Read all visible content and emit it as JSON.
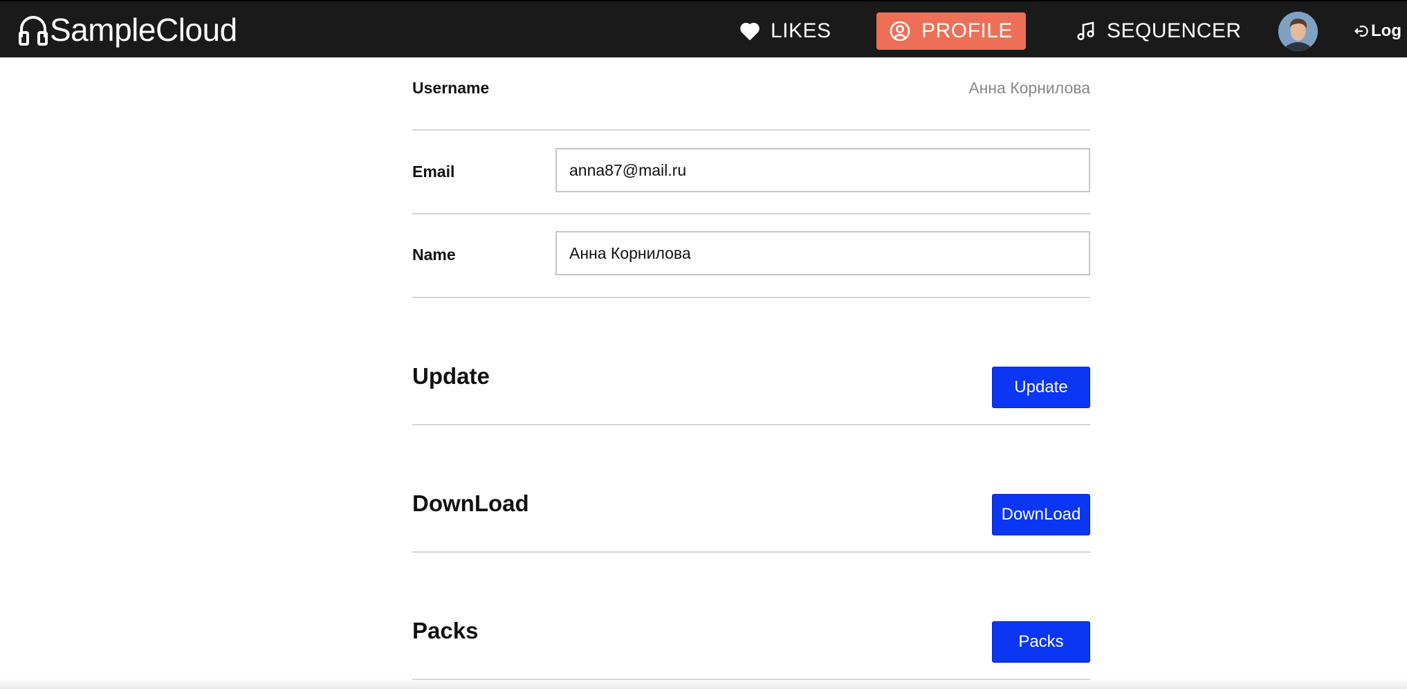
{
  "header": {
    "brand": "SampleCloud",
    "nav": {
      "likes": "LIKES",
      "profile": "PROFILE",
      "sequencer": "SEQUENCER",
      "logout": "Log"
    },
    "active_tab": "profile",
    "accent_color": "#ee6f57"
  },
  "profile": {
    "username_label": "Username",
    "username_value": "Анна Корнилова",
    "email_label": "Email",
    "email_value": "anna87@mail.ru",
    "name_label": "Name",
    "name_value": "Анна Корнилова"
  },
  "sections": {
    "update": {
      "title": "Update",
      "button": "Update"
    },
    "download": {
      "title": "DownLoad",
      "button": "DownLoad"
    },
    "packs": {
      "title": "Packs",
      "button": "Packs"
    },
    "button_color": "#0a36f4"
  },
  "icons": {
    "brand": "headphones-icon",
    "likes": "heart-icon",
    "profile": "user-circle-icon",
    "sequencer": "music-note-icon",
    "logout": "logout-icon"
  }
}
